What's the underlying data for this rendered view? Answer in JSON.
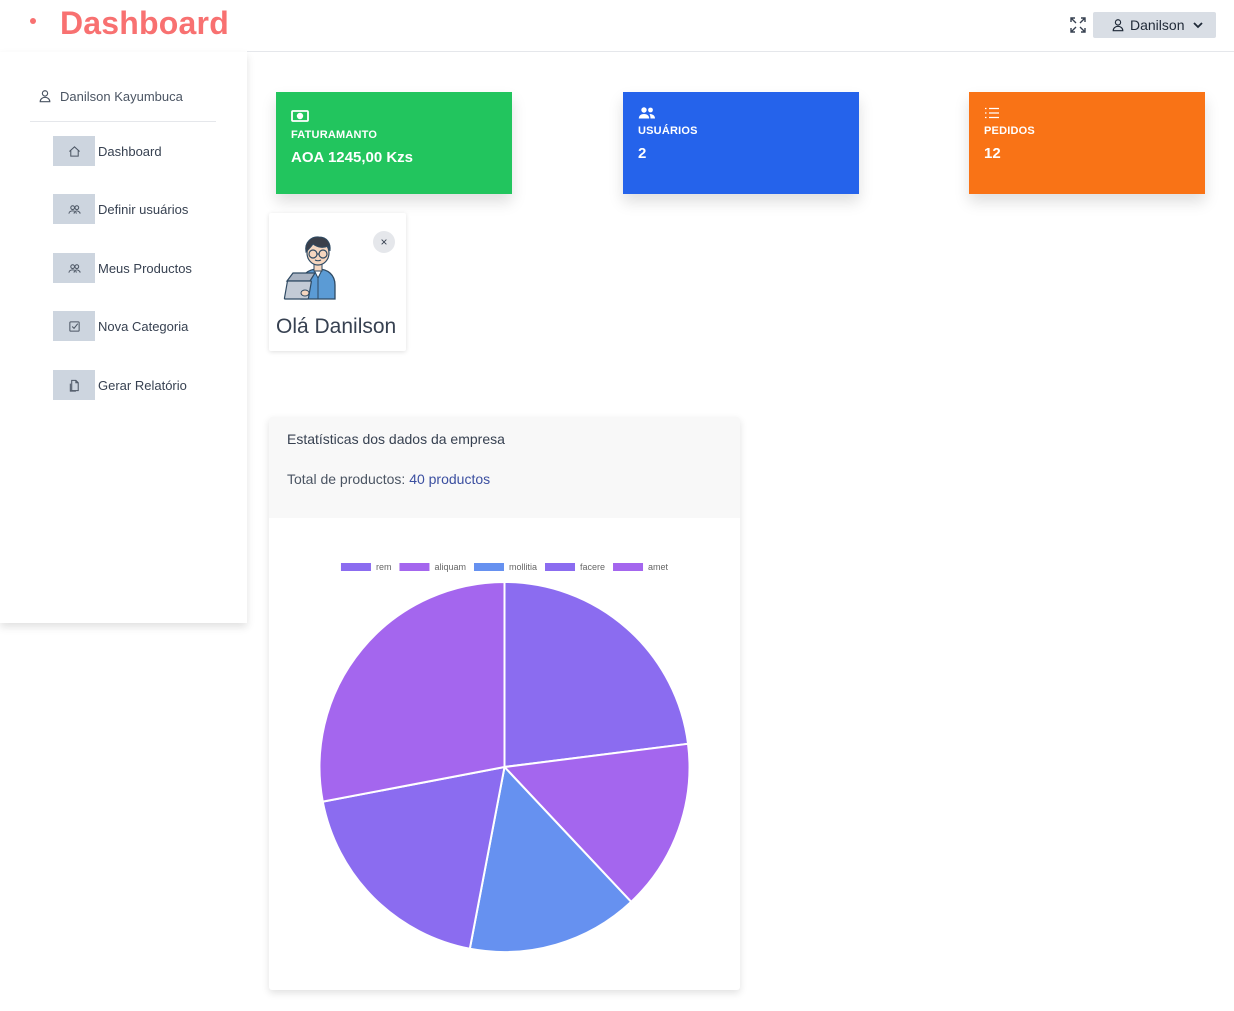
{
  "header": {
    "title": "Dashboard",
    "user_menu_label": "Danilson"
  },
  "sidebar": {
    "user_name": "Danilson Kayumbuca",
    "items": [
      {
        "label": "Dashboard",
        "icon": "home-icon"
      },
      {
        "label": "Definir usuários",
        "icon": "users-icon"
      },
      {
        "label": "Meus Productos",
        "icon": "users-icon"
      },
      {
        "label": "Nova Categoria",
        "icon": "checkbox-icon"
      },
      {
        "label": "Gerar Relatório",
        "icon": "document-icon"
      }
    ]
  },
  "cards": [
    {
      "label": "FATURAMANTO",
      "value": "AOA 1245,00 Kzs",
      "icon": "money-icon",
      "color": "#22c55e"
    },
    {
      "label": "USUÁRIOS",
      "value": "2",
      "icon": "users-icon",
      "color": "#2563eb"
    },
    {
      "label": "PEDIDOS",
      "value": "12",
      "icon": "list-icon",
      "color": "#f97316"
    }
  ],
  "greeting": {
    "text": "Olá Danilson",
    "close_symbol": "×"
  },
  "stats": {
    "title": "Estatísticas dos dados da empresa",
    "total_prefix": "Total de productos: ",
    "total_value": "40 productos"
  },
  "chart_data": {
    "type": "pie",
    "legend_position": "top",
    "categories": [
      "rem",
      "aliquam",
      "mollitia",
      "facere",
      "amet"
    ],
    "values": [
      23,
      15,
      15,
      19,
      28
    ],
    "colors": [
      "#8b6cf0",
      "#a466ee",
      "#6691f0",
      "#8b6cf0",
      "#a466ee"
    ]
  }
}
